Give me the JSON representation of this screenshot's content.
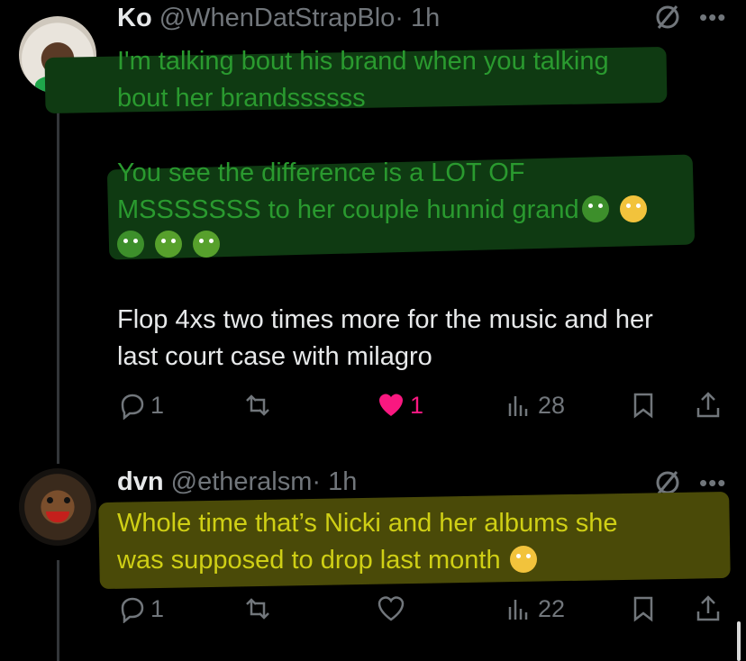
{
  "tweets": [
    {
      "name": "Ko",
      "handle": "@WhenDatStrapBlo",
      "time": "· 1h",
      "lines": [
        "I'm talking bout his brand when you talking",
        "bout her brandssssss",
        "You see the difference is a LOT OF",
        "MSSSSSSS to her couple hunnid grand",
        "Flop 4xs two times more for the music and her",
        "last court case with milagro"
      ],
      "emojis_line3": [
        "nauseated-face",
        "face-with-rolling-eyes"
      ],
      "emojis_line4": [
        "nauseated-face",
        "rolling-on-floor-laughing",
        "rolling-on-floor-laughing"
      ],
      "highlight_color": "#0f3a12",
      "text_color": "#2a9a2f",
      "replies": "1",
      "reposts": "",
      "likes": "1",
      "liked": true,
      "views": "28"
    },
    {
      "name": "dvn",
      "handle": "@etheralsm",
      "time": "· 1h",
      "lines": [
        "Whole time that’s Nicki and her albums she",
        "was supposed to drop last month"
      ],
      "emojis_line2": [
        "loudly-crying-face"
      ],
      "highlight_color": "#4a4a08",
      "text_color": "#cfcf15",
      "replies": "1",
      "reposts": "",
      "likes": "",
      "liked": false,
      "views": "22"
    }
  ],
  "colors": {
    "background": "#000000",
    "muted": "#71767b",
    "like": "#f91880",
    "thread_line": "#333639"
  }
}
